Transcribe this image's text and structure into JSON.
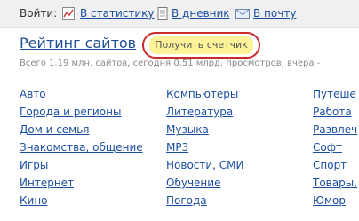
{
  "topbar": {
    "login_label": "Войти:",
    "links": [
      {
        "label": "В статистику",
        "icon": "chart-icon"
      },
      {
        "label": "В дневник",
        "icon": "diary-icon"
      },
      {
        "label": "В почту",
        "icon": "mail-icon"
      }
    ]
  },
  "header": {
    "title": "Рейтинг сайтов",
    "counter_button": "Получить счетчик",
    "stats": "Всего 1.19 млн. сайтов, сегодня 0.51 млрд. просмотров, вчера -"
  },
  "categories": {
    "col1": [
      "Авто",
      "Города и регионы",
      "Дом и семья",
      "Знакомства, общение",
      "Игры",
      "Интернет",
      "Кино"
    ],
    "col2": [
      "Компьютеры",
      "Литература",
      "Музыка",
      "MP3",
      "Новости, СМИ",
      "Обучение",
      "Погода"
    ],
    "col3": [
      "Путеше",
      "Работа",
      "Развлеч",
      "Софт",
      "Спорт",
      "Товары,",
      "Юмор"
    ]
  },
  "colors": {
    "link": "#1a4fa0",
    "title": "#1f4f95",
    "highlight_border": "#c92b2b",
    "button_fill": "#fff39a"
  }
}
